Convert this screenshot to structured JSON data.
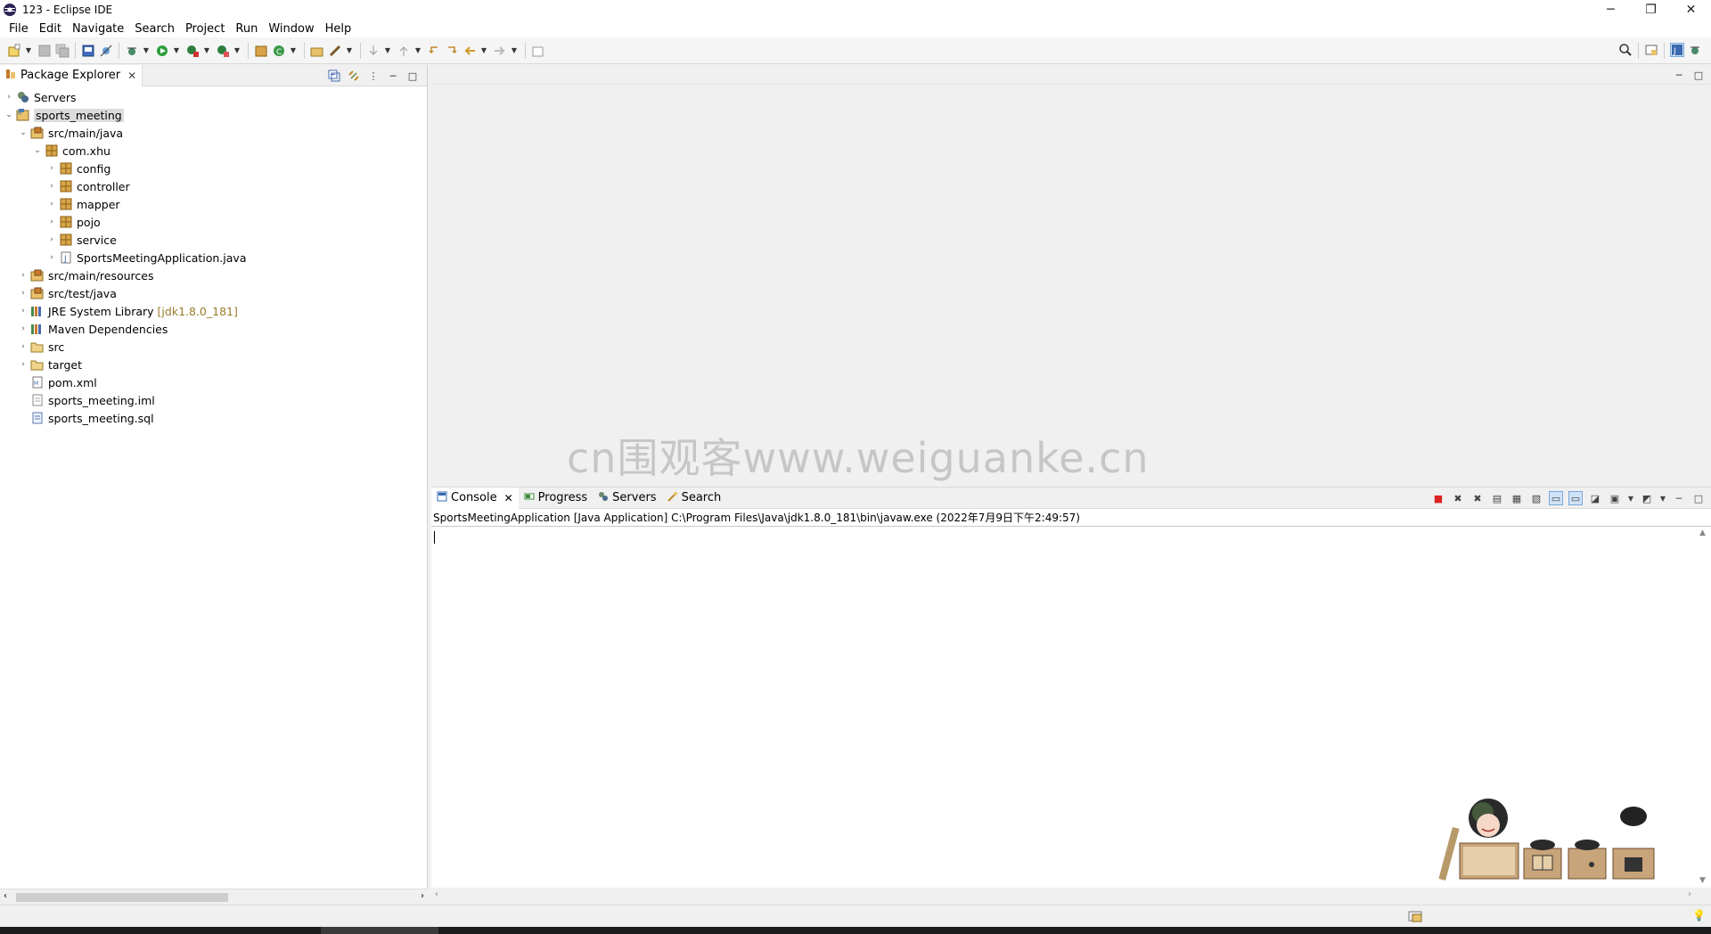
{
  "window": {
    "title": "123 - Eclipse IDE",
    "controls": [
      "─",
      "❐",
      "✕"
    ]
  },
  "menu": [
    "File",
    "Edit",
    "Navigate",
    "Search",
    "Project",
    "Run",
    "Window",
    "Help"
  ],
  "package_explorer": {
    "tab_label": "Package Explorer",
    "tree": [
      {
        "label": "Servers",
        "depth": 0,
        "chevron": "›",
        "icon": "servers-icon"
      },
      {
        "label": "sports_meeting",
        "depth": 0,
        "chevron": "⌄",
        "icon": "project-icon",
        "selected": true
      },
      {
        "label": "src/main/java",
        "depth": 1,
        "chevron": "⌄",
        "icon": "source-folder-icon"
      },
      {
        "label": "com.xhu",
        "depth": 2,
        "chevron": "⌄",
        "icon": "package-icon"
      },
      {
        "label": "config",
        "depth": 3,
        "chevron": "›",
        "icon": "package-icon"
      },
      {
        "label": "controller",
        "depth": 3,
        "chevron": "›",
        "icon": "package-icon"
      },
      {
        "label": "mapper",
        "depth": 3,
        "chevron": "›",
        "icon": "package-icon"
      },
      {
        "label": "pojo",
        "depth": 3,
        "chevron": "›",
        "icon": "package-icon"
      },
      {
        "label": "service",
        "depth": 3,
        "chevron": "›",
        "icon": "package-icon"
      },
      {
        "label": "SportsMeetingApplication.java",
        "depth": 3,
        "chevron": "›",
        "icon": "java-file-icon"
      },
      {
        "label": "src/main/resources",
        "depth": 1,
        "chevron": "›",
        "icon": "source-folder-icon"
      },
      {
        "label": "src/test/java",
        "depth": 1,
        "chevron": "›",
        "icon": "source-folder-icon"
      },
      {
        "label": "JRE System Library",
        "extra": "[jdk1.8.0_181]",
        "depth": 1,
        "chevron": "›",
        "icon": "library-icon"
      },
      {
        "label": "Maven Dependencies",
        "depth": 1,
        "chevron": "›",
        "icon": "library-icon"
      },
      {
        "label": "src",
        "depth": 1,
        "chevron": "›",
        "icon": "folder-icon"
      },
      {
        "label": "target",
        "depth": 1,
        "chevron": "›",
        "icon": "folder-icon"
      },
      {
        "label": "pom.xml",
        "depth": 1,
        "chevron": "",
        "icon": "xml-file-icon"
      },
      {
        "label": "sports_meeting.iml",
        "depth": 1,
        "chevron": "",
        "icon": "file-icon"
      },
      {
        "label": "sports_meeting.sql",
        "depth": 1,
        "chevron": "",
        "icon": "sql-file-icon"
      }
    ]
  },
  "console": {
    "tabs": [
      {
        "label": "Console",
        "icon": "console-icon",
        "active": true
      },
      {
        "label": "Progress",
        "icon": "progress-icon"
      },
      {
        "label": "Servers",
        "icon": "servers-icon"
      },
      {
        "label": "Search",
        "icon": "search-icon"
      }
    ],
    "header": "SportsMeetingApplication [Java Application] C:\\Program Files\\Java\\jdk1.8.0_181\\bin\\javaw.exe  (2022年7月9日下午2:49:57)"
  },
  "watermark": "cn围观客www.weiguanke.cn",
  "colors": {
    "selection": "#dcdcdc",
    "terminate": "#d22222",
    "library_version": "#9a7a2a"
  }
}
